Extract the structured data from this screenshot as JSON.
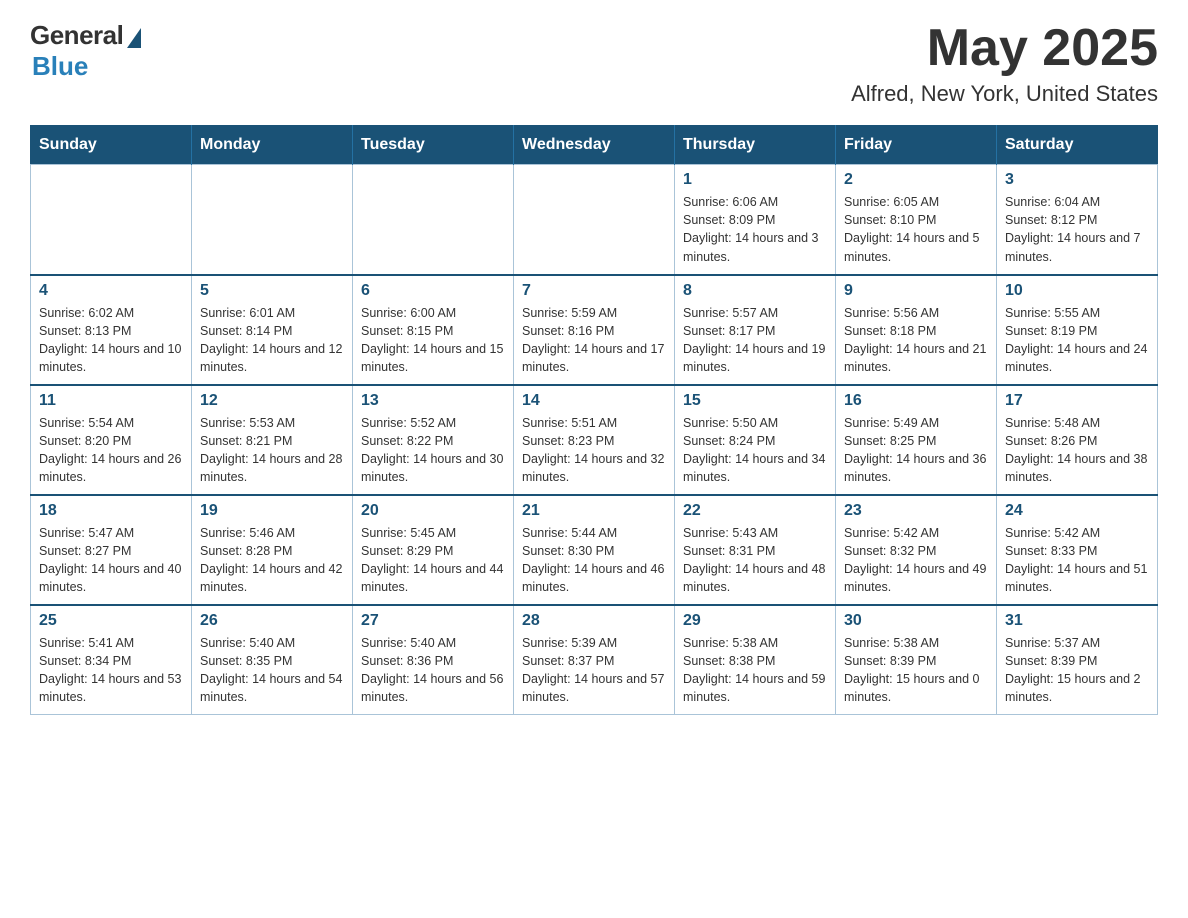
{
  "header": {
    "logo_general": "General",
    "logo_blue": "Blue",
    "month_title": "May 2025",
    "location": "Alfred, New York, United States"
  },
  "days_of_week": [
    "Sunday",
    "Monday",
    "Tuesday",
    "Wednesday",
    "Thursday",
    "Friday",
    "Saturday"
  ],
  "weeks": [
    [
      {
        "day": "",
        "info": ""
      },
      {
        "day": "",
        "info": ""
      },
      {
        "day": "",
        "info": ""
      },
      {
        "day": "",
        "info": ""
      },
      {
        "day": "1",
        "info": "Sunrise: 6:06 AM\nSunset: 8:09 PM\nDaylight: 14 hours and 3 minutes."
      },
      {
        "day": "2",
        "info": "Sunrise: 6:05 AM\nSunset: 8:10 PM\nDaylight: 14 hours and 5 minutes."
      },
      {
        "day": "3",
        "info": "Sunrise: 6:04 AM\nSunset: 8:12 PM\nDaylight: 14 hours and 7 minutes."
      }
    ],
    [
      {
        "day": "4",
        "info": "Sunrise: 6:02 AM\nSunset: 8:13 PM\nDaylight: 14 hours and 10 minutes."
      },
      {
        "day": "5",
        "info": "Sunrise: 6:01 AM\nSunset: 8:14 PM\nDaylight: 14 hours and 12 minutes."
      },
      {
        "day": "6",
        "info": "Sunrise: 6:00 AM\nSunset: 8:15 PM\nDaylight: 14 hours and 15 minutes."
      },
      {
        "day": "7",
        "info": "Sunrise: 5:59 AM\nSunset: 8:16 PM\nDaylight: 14 hours and 17 minutes."
      },
      {
        "day": "8",
        "info": "Sunrise: 5:57 AM\nSunset: 8:17 PM\nDaylight: 14 hours and 19 minutes."
      },
      {
        "day": "9",
        "info": "Sunrise: 5:56 AM\nSunset: 8:18 PM\nDaylight: 14 hours and 21 minutes."
      },
      {
        "day": "10",
        "info": "Sunrise: 5:55 AM\nSunset: 8:19 PM\nDaylight: 14 hours and 24 minutes."
      }
    ],
    [
      {
        "day": "11",
        "info": "Sunrise: 5:54 AM\nSunset: 8:20 PM\nDaylight: 14 hours and 26 minutes."
      },
      {
        "day": "12",
        "info": "Sunrise: 5:53 AM\nSunset: 8:21 PM\nDaylight: 14 hours and 28 minutes."
      },
      {
        "day": "13",
        "info": "Sunrise: 5:52 AM\nSunset: 8:22 PM\nDaylight: 14 hours and 30 minutes."
      },
      {
        "day": "14",
        "info": "Sunrise: 5:51 AM\nSunset: 8:23 PM\nDaylight: 14 hours and 32 minutes."
      },
      {
        "day": "15",
        "info": "Sunrise: 5:50 AM\nSunset: 8:24 PM\nDaylight: 14 hours and 34 minutes."
      },
      {
        "day": "16",
        "info": "Sunrise: 5:49 AM\nSunset: 8:25 PM\nDaylight: 14 hours and 36 minutes."
      },
      {
        "day": "17",
        "info": "Sunrise: 5:48 AM\nSunset: 8:26 PM\nDaylight: 14 hours and 38 minutes."
      }
    ],
    [
      {
        "day": "18",
        "info": "Sunrise: 5:47 AM\nSunset: 8:27 PM\nDaylight: 14 hours and 40 minutes."
      },
      {
        "day": "19",
        "info": "Sunrise: 5:46 AM\nSunset: 8:28 PM\nDaylight: 14 hours and 42 minutes."
      },
      {
        "day": "20",
        "info": "Sunrise: 5:45 AM\nSunset: 8:29 PM\nDaylight: 14 hours and 44 minutes."
      },
      {
        "day": "21",
        "info": "Sunrise: 5:44 AM\nSunset: 8:30 PM\nDaylight: 14 hours and 46 minutes."
      },
      {
        "day": "22",
        "info": "Sunrise: 5:43 AM\nSunset: 8:31 PM\nDaylight: 14 hours and 48 minutes."
      },
      {
        "day": "23",
        "info": "Sunrise: 5:42 AM\nSunset: 8:32 PM\nDaylight: 14 hours and 49 minutes."
      },
      {
        "day": "24",
        "info": "Sunrise: 5:42 AM\nSunset: 8:33 PM\nDaylight: 14 hours and 51 minutes."
      }
    ],
    [
      {
        "day": "25",
        "info": "Sunrise: 5:41 AM\nSunset: 8:34 PM\nDaylight: 14 hours and 53 minutes."
      },
      {
        "day": "26",
        "info": "Sunrise: 5:40 AM\nSunset: 8:35 PM\nDaylight: 14 hours and 54 minutes."
      },
      {
        "day": "27",
        "info": "Sunrise: 5:40 AM\nSunset: 8:36 PM\nDaylight: 14 hours and 56 minutes."
      },
      {
        "day": "28",
        "info": "Sunrise: 5:39 AM\nSunset: 8:37 PM\nDaylight: 14 hours and 57 minutes."
      },
      {
        "day": "29",
        "info": "Sunrise: 5:38 AM\nSunset: 8:38 PM\nDaylight: 14 hours and 59 minutes."
      },
      {
        "day": "30",
        "info": "Sunrise: 5:38 AM\nSunset: 8:39 PM\nDaylight: 15 hours and 0 minutes."
      },
      {
        "day": "31",
        "info": "Sunrise: 5:37 AM\nSunset: 8:39 PM\nDaylight: 15 hours and 2 minutes."
      }
    ]
  ]
}
